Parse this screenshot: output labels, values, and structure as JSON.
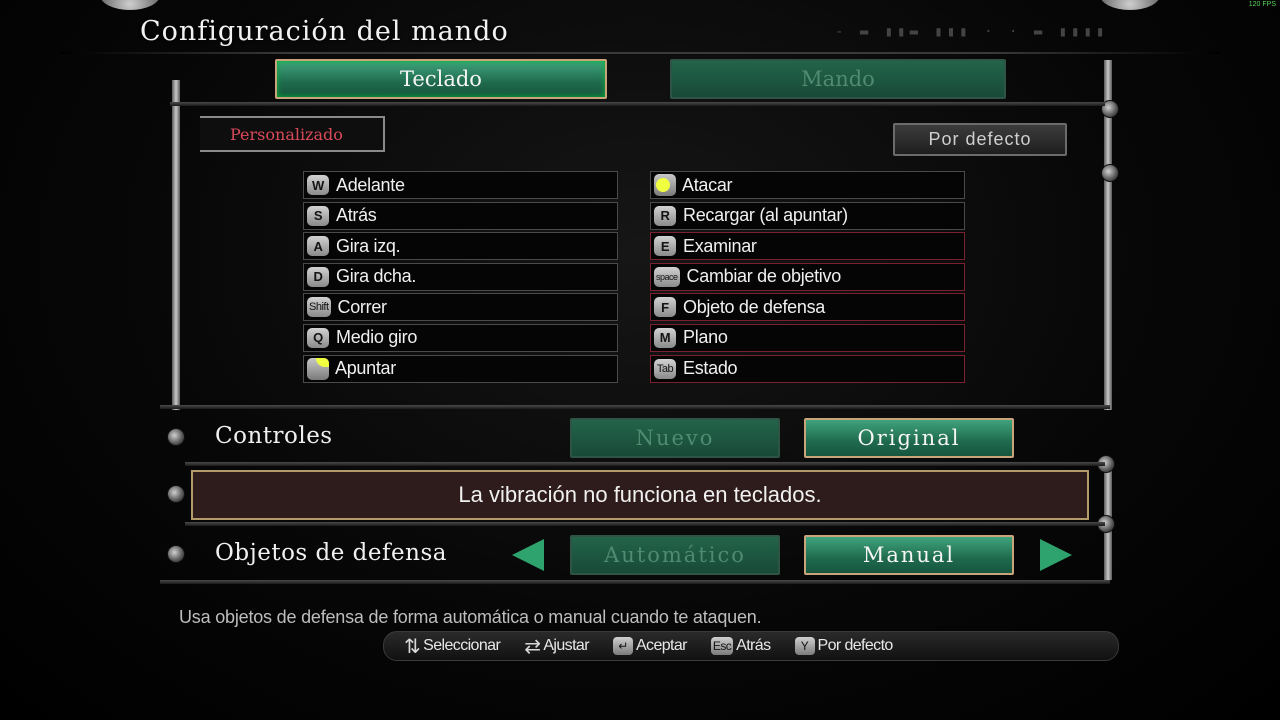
{
  "header": {
    "title": "Configuración del mando",
    "fps": "120 FPS"
  },
  "tabs": [
    {
      "label": "Teclado",
      "active": true
    },
    {
      "label": "Mando",
      "active": false
    }
  ],
  "preset": {
    "label": "Personalizado"
  },
  "defaults_button": {
    "label": "Por defecto"
  },
  "left_bindings": [
    {
      "key": "W",
      "action": "Adelante"
    },
    {
      "key": "S",
      "action": "Atrás"
    },
    {
      "key": "A",
      "action": "Gira izq."
    },
    {
      "key": "D",
      "action": "Gira dcha."
    },
    {
      "key": "Shift",
      "action": "Correr"
    },
    {
      "key": "Q",
      "action": "Medio giro"
    },
    {
      "key": "mouse-right-icon",
      "action": "Apuntar"
    }
  ],
  "right_bindings": [
    {
      "key": "mouse-left-icon",
      "action": "Atacar"
    },
    {
      "key": "R",
      "action": "Recargar (al apuntar)"
    },
    {
      "key": "E",
      "action": "Examinar"
    },
    {
      "key": "space",
      "action": "Cambiar de objetivo"
    },
    {
      "key": "F",
      "action": "Objeto de defensa"
    },
    {
      "key": "M",
      "action": "Plano"
    },
    {
      "key": "Tab",
      "action": "Estado"
    }
  ],
  "controls_row": {
    "label": "Controles",
    "options": [
      {
        "label": "Nuevo",
        "active": false
      },
      {
        "label": "Original",
        "active": true
      }
    ]
  },
  "info_message": "La vibración no funciona en teclados.",
  "defense_row": {
    "label": "Objetos de defensa",
    "options": [
      {
        "label": "Automático",
        "active": false
      },
      {
        "label": "Manual",
        "active": true
      }
    ]
  },
  "help_text": "Usa objetos de defensa de forma automática o manual cuando te ataquen.",
  "legend": [
    {
      "key": "arrows-updown-icon",
      "label": "Seleccionar"
    },
    {
      "key": "arrows-leftright-icon",
      "label": "Ajustar"
    },
    {
      "key": "enter-icon",
      "label": "Aceptar"
    },
    {
      "key": "Esc",
      "label": "Atrás"
    },
    {
      "key": "Y",
      "label": "Por defecto"
    }
  ],
  "colors": {
    "accent_green": "#2fa36d",
    "preset_red": "#d84a5a",
    "info_bg": "#2e1c1c"
  }
}
